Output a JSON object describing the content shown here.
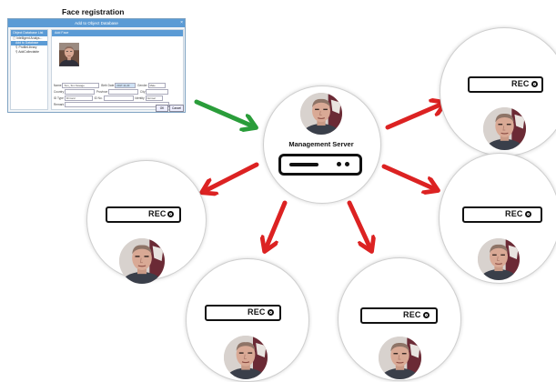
{
  "face_registration": {
    "title": "Face registration",
    "dialog": {
      "window_title": "Add to Object Database",
      "close_glyph": "×",
      "side_header": "Object Database List",
      "tree_items": [
        "Intelligent Analys...",
        "Add to Database",
        "ProfileLibrary",
        "AddCollectable"
      ],
      "main_header": "Add Face",
      "fields": {
        "name_label": "Name",
        "name_value": "Tom_Tom Savage",
        "birth_label": "Birth Date",
        "birth_value": "2017-11-20",
        "gender_label": "Gender",
        "gender_value": "Male",
        "country_label": "Country",
        "province_label": "Province",
        "city_label": "City",
        "id_type_label": "ID Type",
        "id_type_value": "ID Card",
        "id_no_label": "ID No.",
        "identity_label": "Identity",
        "identity_value": "Normal",
        "remark_label": "Remark"
      },
      "ok_label": "OK",
      "cancel_label": "Cancel"
    }
  },
  "management_server": {
    "label": "Management Server"
  },
  "recorders": {
    "rec_label": "REC",
    "count": 5
  },
  "colors": {
    "registration_arrow": "#2a9d3a",
    "distribution_arrow": "#dc2222",
    "circle_border": "#cfcfcf"
  }
}
